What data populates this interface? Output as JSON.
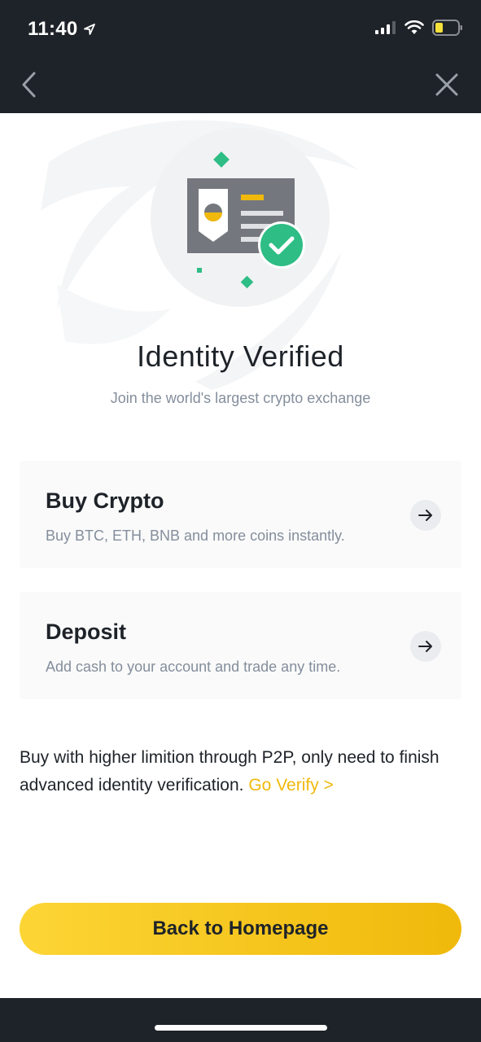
{
  "status_bar": {
    "time": "11:40",
    "icons": [
      "location-arrow-icon",
      "signal-icon",
      "wifi-icon",
      "battery-icon"
    ]
  },
  "nav": {
    "back_icon": "chevron-left-icon",
    "close_icon": "close-icon"
  },
  "hero": {
    "illustration": "id-card-verified-icon",
    "title": "Identity Verified",
    "subtitle": "Join the world's largest crypto exchange"
  },
  "cards": [
    {
      "title": "Buy Crypto",
      "description": "Buy BTC, ETH, BNB and more coins instantly.",
      "icon": "arrow-right-icon"
    },
    {
      "title": "Deposit",
      "description": "Add cash to your account and trade any time.",
      "icon": "arrow-right-icon"
    }
  ],
  "note": {
    "text": "Buy with higher limition through P2P, only need to finish advanced identity verification.",
    "link_label": "Go Verify  >"
  },
  "primary_button": {
    "label": "Back to Homepage"
  },
  "colors": {
    "accent": "#f0b90b",
    "accent_light": "#fcd535",
    "success": "#2ebd85",
    "dark_bar": "#1e2329",
    "muted_text": "#848e9c"
  }
}
